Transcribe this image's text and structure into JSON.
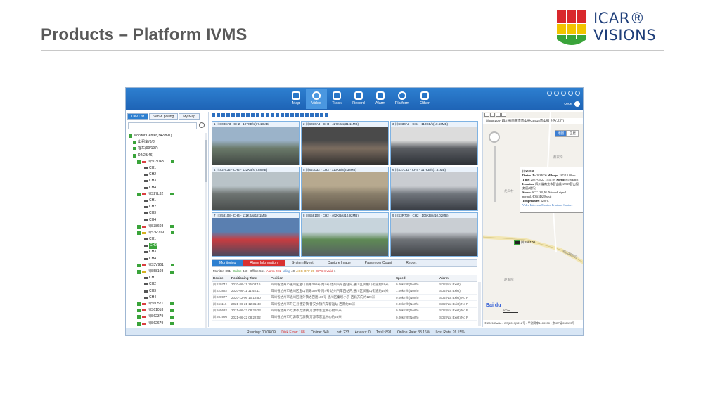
{
  "slide": {
    "title": "Products – Platform IVMS",
    "logo_line1": "ICAR®",
    "logo_line2": "VISIONS",
    "colors": {
      "logo_red": "#d9282c",
      "logo_yellow": "#f2c400",
      "logo_green": "#3aa43a",
      "logo_navy": "#1f3f7a"
    }
  },
  "app": {
    "nav": [
      {
        "label": "Map",
        "icon": "map-icon"
      },
      {
        "label": "Video",
        "icon": "video-icon"
      },
      {
        "label": "Track",
        "icon": "track-icon"
      },
      {
        "label": "Record",
        "icon": "record-icon"
      },
      {
        "label": "Alarm",
        "icon": "alarm-icon"
      },
      {
        "label": "Platform",
        "icon": "platform-icon"
      },
      {
        "label": "Other",
        "icon": "other-icon"
      }
    ],
    "user": "cece",
    "sidebar": {
      "tabs": [
        "Dev List",
        "Veh & polling",
        "My Map"
      ],
      "tree": [
        {
          "text": "Monitor Center(342/891)",
          "kind": "root"
        },
        {
          "text": "出租车(0/8)",
          "kind": "group"
        },
        {
          "text": "客车(99/197)",
          "kind": "group"
        },
        {
          "text": "D2(23/46)",
          "kind": "group"
        },
        {
          "text": "川S030A3",
          "kind": "veh"
        },
        {
          "text": "CH1",
          "kind": "cam"
        },
        {
          "text": "CH2",
          "kind": "cam"
        },
        {
          "text": "CH3",
          "kind": "cam"
        },
        {
          "text": "CH4",
          "kind": "cam"
        },
        {
          "text": "川S27L32",
          "kind": "veh"
        },
        {
          "text": "CH1",
          "kind": "cam"
        },
        {
          "text": "CH2",
          "kind": "cam"
        },
        {
          "text": "CH3",
          "kind": "cam"
        },
        {
          "text": "CH4",
          "kind": "cam"
        },
        {
          "text": "川S38608",
          "kind": "veh"
        },
        {
          "text": "川S3R709",
          "kind": "vehy"
        },
        {
          "text": "CH1",
          "kind": "cam"
        },
        {
          "text": "CH2",
          "kind": "camhl"
        },
        {
          "text": "CH3",
          "kind": "cam"
        },
        {
          "text": "CH4",
          "kind": "cam"
        },
        {
          "text": "川S3V961",
          "kind": "veh"
        },
        {
          "text": "川S58108",
          "kind": "vehy"
        },
        {
          "text": "CH1",
          "kind": "cam"
        },
        {
          "text": "CH2",
          "kind": "cam"
        },
        {
          "text": "CH3",
          "kind": "cam"
        },
        {
          "text": "CH4",
          "kind": "cam"
        },
        {
          "text": "川S60571",
          "kind": "veh"
        },
        {
          "text": "川S61018",
          "kind": "veh"
        },
        {
          "text": "川S62379",
          "kind": "veh"
        },
        {
          "text": "川S62679",
          "kind": "veh"
        }
      ]
    },
    "videos": [
      {
        "label": "1    川S030A3 - CH2 - 197KB/s(17.18MB)"
      },
      {
        "label": "2    川S030A3 - CH3 - 427KB/s(31.11MB)"
      },
      {
        "label": "3    川S030A3 - CH4 - 110KB/s(10.66MB)"
      },
      {
        "label": "4    川S27L32 - CH2 - 122KB/s(7.88MB)"
      },
      {
        "label": "5    川S27L32 - CH3 - 110KB/s(8.38MB)"
      },
      {
        "label": "6    川S27L32 - CH4 - 117KB/s(7.81MB)"
      },
      {
        "label": "7    川S58108 - CH4 - 111KB/s(12.1MB)"
      },
      {
        "label": "8    川S58108 - CH2 - 462KB/s(10.92MB)"
      },
      {
        "label": "9    川S3R709 - CH2 - 106KB/s(10.02MB)"
      }
    ],
    "bottom_tabs": [
      "Monitoring",
      "Alarm Information",
      "System Event",
      "Capture Image",
      "Passenger Count",
      "Report"
    ],
    "summary": {
      "monitor_label": "Monitor:",
      "monitor": "891",
      "online_label": "Online",
      "online": "340",
      "offline_label": "Offline",
      "offline": "551",
      "alarm_label": "Alarm",
      "alarm": "201",
      "idling_label": "Idling",
      "idling": "40",
      "acc_label": "ACC OFF",
      "acc": "26",
      "gps_label": "GPS Invalid",
      "gps": "1"
    },
    "table": {
      "columns": [
        "Device",
        "Positioning Time",
        "Position",
        "Speed",
        "Alarm"
      ],
      "rows": [
        [
          "川S29742",
          "2020-06-11 15:03:16",
          "四川省达州市通川区金山南路380号-附4号 达州汽车西站内,通川区凤凰山街道约18米",
          "0.00km/h(North)",
          "SD2(Not Exist)"
        ],
        [
          "川S23882",
          "2020-06-11 11:45:11",
          "四川省达州市通川区金山南路380号-附4号 达州汽车西站内,通川区凤凰山街道约16米",
          "1.00km/h(North)",
          "SD2(Not Exist)"
        ],
        [
          "川S28977",
          "2020-12-06 10:18:50",
          "四川省达州市通川区北外镇达巴路180号 通川区秦坝小学-西北方向约129米",
          "0.00km/h(North)",
          "SD2(Not Exist),No R"
        ],
        [
          "川S61116",
          "2021-06-21 12:31:48",
          "四川省达州市开江县普安镇 普安乡镇汽车客运站-西南约38米",
          "0.00km/h(North)",
          "SD2(Not Exist),No R"
        ],
        [
          "川S65632",
          "2021-06-22 08:29:23",
          "四川省达州市万源市万源镇 万源市客运中心约31米",
          "0.00km/h(North)",
          "SD2(Not Exist),No R"
        ],
        [
          "川S61996",
          "2021-06-22 08:22:02",
          "四川省达州市万源市万源镇 万源市客运中心约28米",
          "0.00km/h(North)",
          "SD2(Not Exist),No R"
        ]
      ]
    },
    "map": {
      "header": "川S58108- 四川省南充市营山县G5515营山服务区(北行)",
      "types": [
        "地图",
        "卫星"
      ],
      "popup": {
        "title": "川S58108",
        "device_id_label": "Device ID:",
        "device_id": "2034006",
        "mileage_label": "Mileage:",
        "mileage": "187413.00km",
        "time_label": "Time:",
        "time": "2021-06-22 15:41:09",
        "speed_label": "Speed:",
        "speed": "85.00km/h",
        "location_label": "Location:",
        "location": "四川省南充市营山县G5515营山服务区(北行)",
        "status_label": "Status:",
        "status": "ACC ON,4G Network signal normal,HD1(SD2(Exist)",
        "temp_label": "Temperature:",
        "temp": "32.0°C",
        "links": "Video  Intercom  Monitor  Print and Capture"
      },
      "marker_label": "川S58108",
      "places": [
        "蔡家沟",
        "龙头村",
        "营山服务区",
        "赵家院"
      ],
      "scale": "200 m",
      "baidu": "Bai du",
      "footer": "© 2021 Baidu - GS(2019)5218号 - 甲测资字1100930 - 京ICP证030173号"
    },
    "status": {
      "running": "Running: 00:04:09",
      "disk_error": "Disk Error: 188",
      "online": "Online: 340",
      "lost": "Lost: 233",
      "arrears": "Arrears: 0",
      "total": "Total: 891",
      "online_rate": "Online Rate: 38.16%",
      "lost_rate": "Lost Rate: 26.15%"
    }
  }
}
